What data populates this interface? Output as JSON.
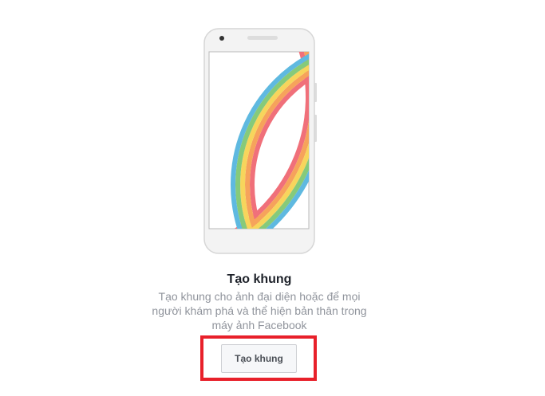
{
  "illustration": {
    "icon": "phone-with-rainbow-frame-illustration",
    "rainbow_colors": [
      "#f0707a",
      "#f6a35b",
      "#f7d55c",
      "#86ca7a",
      "#5fb9e0"
    ]
  },
  "empty_state": {
    "title": "Tạo khung",
    "description": "Tạo khung cho ảnh đại diện hoặc để mọi người khám phá và thể hiện bản thân trong máy ảnh Facebook",
    "button_label": "Tạo khung"
  },
  "annotation": {
    "highlight_color": "#e8202a"
  }
}
